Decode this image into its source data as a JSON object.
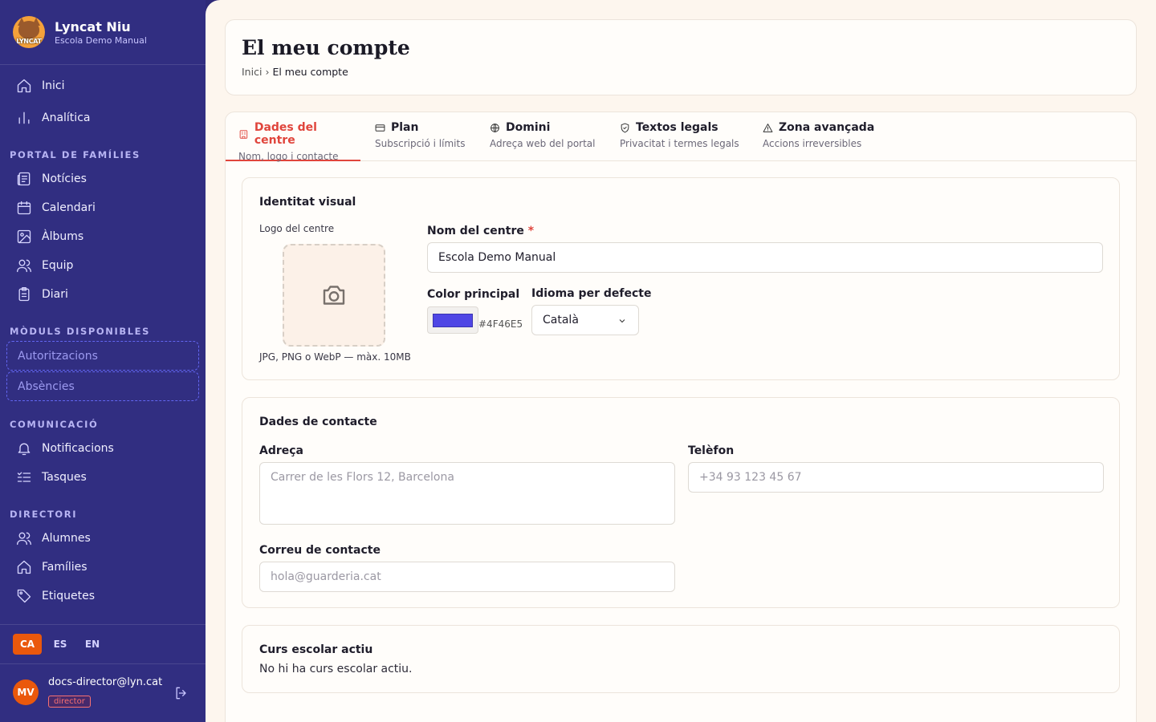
{
  "brand": {
    "name": "Lyncat Niu",
    "subtitle": "Escola Demo Manual",
    "logo_text": "LYNCAT"
  },
  "nav": {
    "top": [
      {
        "label": "Inici",
        "icon": "home-icon"
      },
      {
        "label": "Analítica",
        "icon": "bar-chart-icon"
      }
    ],
    "sections": {
      "portal": "PORTAL DE FAMÍLIES",
      "modules": "MÒDULS DISPONIBLES",
      "communication": "COMUNICACIÓ",
      "director": "DIRECTORI"
    },
    "portal_items": [
      {
        "label": "Notícies",
        "icon": "newspaper-icon"
      },
      {
        "label": "Calendari",
        "icon": "calendar-icon"
      },
      {
        "label": "Àlbums",
        "icon": "image-icon"
      },
      {
        "label": "Equip",
        "icon": "users-icon"
      },
      {
        "label": "Diari",
        "icon": "clipboard-icon"
      }
    ],
    "module_items": [
      {
        "label": "Autoritzacions"
      },
      {
        "label": "Absències"
      }
    ],
    "communication_items": [
      {
        "label": "Notificacions",
        "icon": "bell-icon"
      },
      {
        "label": "Tasques",
        "icon": "tasks-icon"
      }
    ],
    "director_items": [
      {
        "label": "Alumnes",
        "icon": "users-icon"
      },
      {
        "label": "Famílies",
        "icon": "home-icon"
      },
      {
        "label": "Etiquetes",
        "icon": "tag-icon"
      }
    ]
  },
  "languages": [
    "CA",
    "ES",
    "EN"
  ],
  "active_language": "CA",
  "user": {
    "initials": "MV",
    "email": "docs-director@lyn.cat",
    "role": "director"
  },
  "page": {
    "title": "El meu compte",
    "breadcrumb": {
      "home": "Inici",
      "separator": "›",
      "current": "El meu compte"
    }
  },
  "tabs": [
    {
      "title": "Dades del centre",
      "subtitle": "Nom, logo i contacte",
      "icon": "building-icon",
      "active": true
    },
    {
      "title": "Plan",
      "subtitle": "Subscripció i límits",
      "icon": "credit-card-icon",
      "active": false
    },
    {
      "title": "Domini",
      "subtitle": "Adreça web del portal",
      "icon": "globe-icon",
      "active": false
    },
    {
      "title": "Textos legals",
      "subtitle": "Privacitat i termes legals",
      "icon": "shield-check-icon",
      "active": false
    },
    {
      "title": "Zona avançada",
      "subtitle": "Accions irreversibles",
      "icon": "warning-icon",
      "active": false
    }
  ],
  "identity": {
    "title": "Identitat visual",
    "logo_label": "Logo del centre",
    "logo_hint": "JPG, PNG o WebP — màx. 10MB",
    "name_label": "Nom del centre",
    "required_mark": "*",
    "name_value": "Escola Demo Manual",
    "color_label": "Color principal",
    "color_value": "#4F46E5",
    "language_label": "Idioma per defecte",
    "language_value": "Català"
  },
  "contact": {
    "title": "Dades de contacte",
    "address_label": "Adreça",
    "address_placeholder": "Carrer de les Flors 12, Barcelona",
    "phone_label": "Telèfon",
    "phone_placeholder": "+34 93 123 45 67",
    "email_label": "Correu de contacte",
    "email_placeholder": "hola@guarderia.cat"
  },
  "school_year": {
    "title": "Curs escolar actiu",
    "empty": "No hi ha curs escolar actiu."
  },
  "colors": {
    "sidebar": "#312e81",
    "accent": "#e0453c",
    "brand_primary": "#4F46E5",
    "avatar": "#ea580c"
  }
}
